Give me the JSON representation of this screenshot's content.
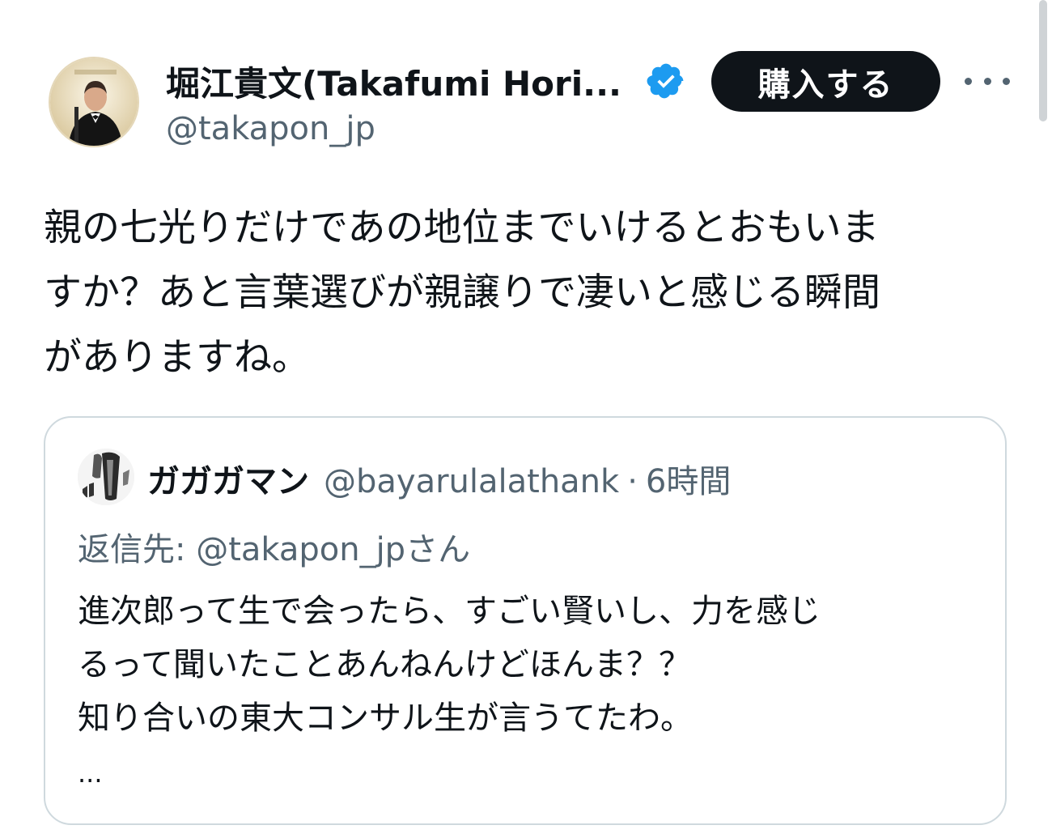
{
  "author": {
    "display_name": "堀江貴文(Takafumi Hori...",
    "handle": "@takapon_jp",
    "avatar_icon": "avatar-photo",
    "verified_icon": "verified-badge-icon",
    "verified_color": "#1d9bf0"
  },
  "actions": {
    "subscribe_label": "購入する",
    "more_icon": "more-options-icon"
  },
  "tweet": {
    "text": "親の七光りだけであの地位までいけるとおもいま\nすか？あと言葉選びが親譲りで凄いと感じる瞬間\nがありますね。"
  },
  "quoted_tweet": {
    "display_name": "ガガガマン",
    "handle": "@bayarulalathank",
    "separator": "·",
    "time": "6時間",
    "replying_to": "返信先: @takapon_jpさん",
    "text": "進次郎って生で会ったら、すごい賢いし、力を感じ\nるって聞いたことあんねんけどほんま？？\n知り合いの東大コンサル生が言うてたわ。",
    "ellipsis": "..."
  },
  "colors": {
    "text_primary": "#0f1419",
    "text_secondary": "#536471",
    "button_bg": "#0f1419",
    "card_border": "#cfd9de"
  }
}
